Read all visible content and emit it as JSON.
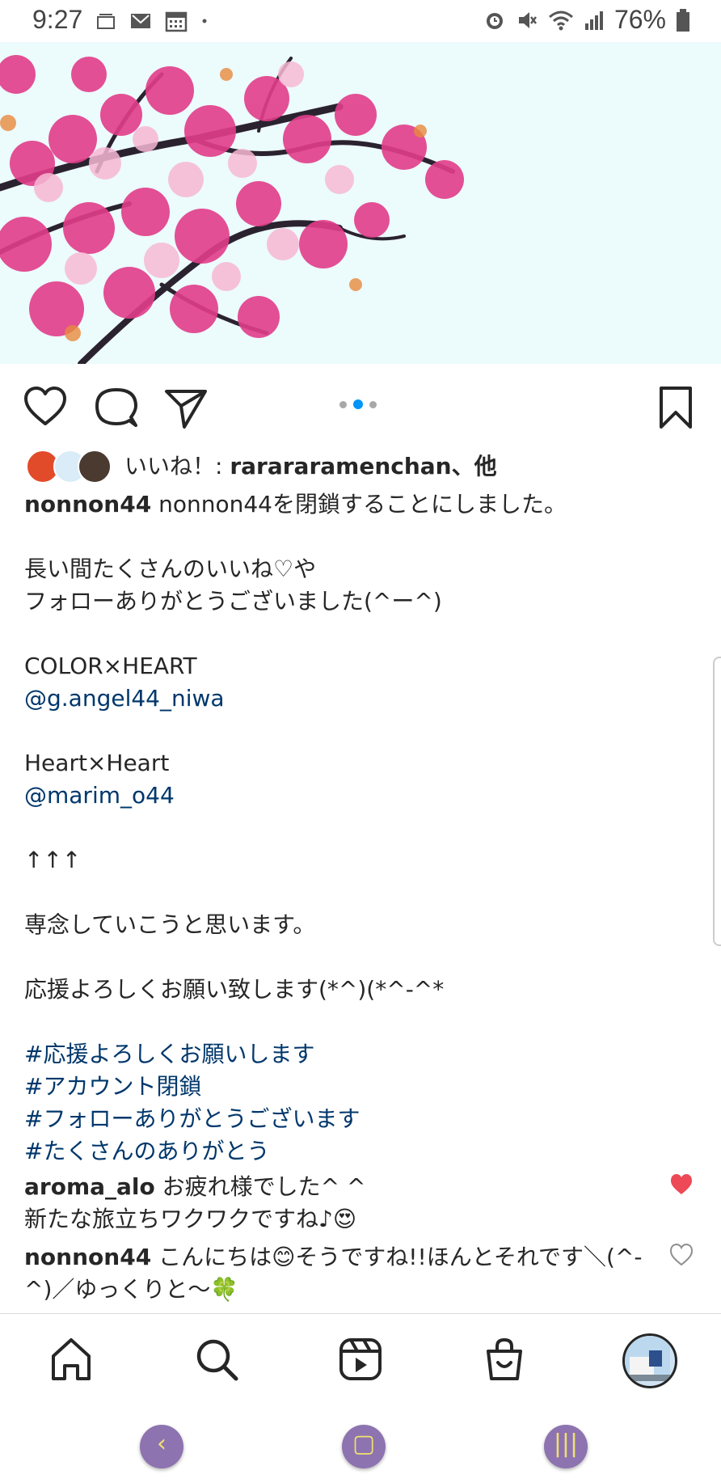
{
  "status_bar": {
    "time": "9:27",
    "battery": "76%",
    "left_icons": [
      "amazon-icon",
      "mail-icon",
      "calendar-icon",
      "dot-icon"
    ],
    "right_icons": [
      "alarm-icon",
      "mute-icon",
      "wifi-icon",
      "signal-icon",
      "battery-icon"
    ]
  },
  "post": {
    "image": "cherry-blossom-branch",
    "carousel": {
      "count": 3,
      "active": 2
    }
  },
  "likes": {
    "prefix": "いいね！: ",
    "user": "rarararamenchan",
    "suffix": "、他"
  },
  "caption": {
    "user": "nonnon44",
    "lines": [
      " nonnon44を閉鎖することにしました。",
      "",
      "長い間たくさんのいいね♡や",
      "フォローありがとうございました(^ー^)",
      "",
      "COLOR×HEART",
      "@g.angel44_niwa",
      "",
      "Heart×Heart",
      "@marim_o44",
      "",
      "↑↑↑",
      "",
      "専念していこうと思います。",
      "",
      "応援よろしくお願い致します(*^)(*^-^*",
      "",
      "#応援よろしくお願いします",
      "#アカウント閉鎖",
      "#フォローありがとうございます",
      "#たくさんのありがとう"
    ]
  },
  "comments": [
    {
      "user": "aroma_alo",
      "line1": " お疲れ様でした^ ^",
      "line2": "新たな旅立ちワクワクですね♪😍",
      "liked": true
    },
    {
      "user": "nonnon44",
      "line1": " こんにちは😊そうですね!!ほんとそれです＼(^-",
      "line2": "^)／ゆっくりと〜🍀",
      "liked": false
    }
  ],
  "nav": {
    "items": [
      "home-icon",
      "search-icon",
      "reels-icon",
      "shop-icon",
      "profile-avatar"
    ]
  },
  "colors": {
    "link": "#00376b",
    "active_dot": "#0095f6",
    "liked_heart": "#ed4956"
  }
}
